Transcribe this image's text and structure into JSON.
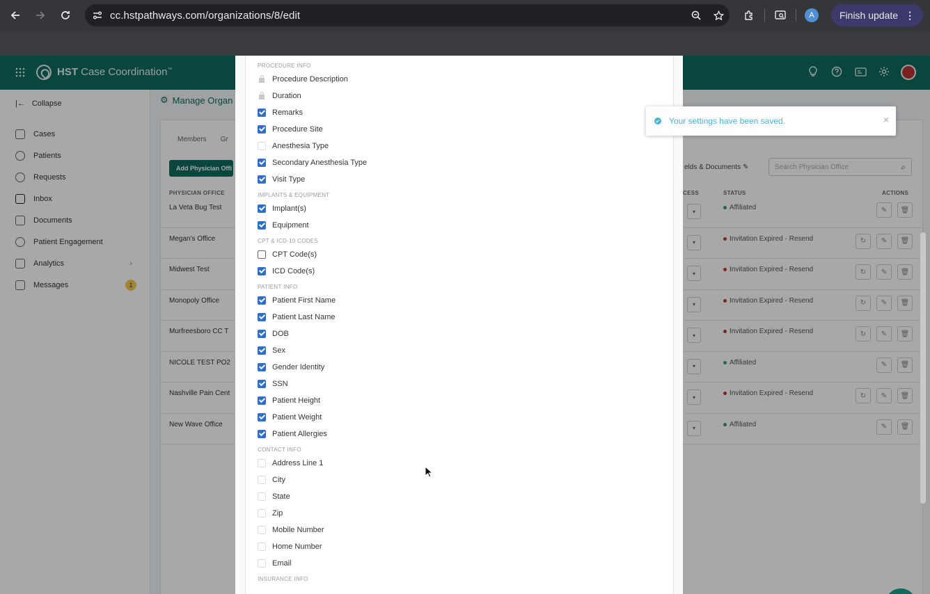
{
  "browser": {
    "url": "cc.hstpathways.com/organizations/8/edit",
    "avatar_letter": "A",
    "finish_update_label": "Finish update"
  },
  "app": {
    "brand_bold": "HST",
    "brand_rest": " Case Coordination",
    "brand_mark": "™",
    "colors": {
      "brand": "#0f6b5e",
      "checkbox": "#2f6fc4",
      "toast": "#4ab3d6"
    }
  },
  "sidebar": {
    "collapse_label": "Collapse",
    "items": [
      {
        "label": "Cases",
        "icon": "briefcase-icon"
      },
      {
        "label": "Patients",
        "icon": "users-icon"
      },
      {
        "label": "Requests",
        "icon": "check-circle-icon"
      },
      {
        "label": "Inbox",
        "icon": "inbox-icon"
      },
      {
        "label": "Documents",
        "icon": "document-icon"
      },
      {
        "label": "Patient Engagement",
        "icon": "engagement-icon"
      },
      {
        "label": "Analytics",
        "icon": "chart-icon"
      },
      {
        "label": "Messages",
        "icon": "message-icon",
        "badge": "1"
      }
    ]
  },
  "main": {
    "manage_tab": "Manage Organ",
    "subtabs": [
      "Members",
      "Gr"
    ],
    "add_button": "Add Physician Offi",
    "fields_link": "elds & Documents",
    "search_placeholder": "Search Physician Office",
    "columns": {
      "office": "PHYSICIAN OFFICE",
      "access": "CESS",
      "status": "STATUS",
      "actions": "ACTIONS"
    },
    "rows": [
      {
        "name": "La Veta Bug Test",
        "status": "Affiliated",
        "dot": "#2fa36b"
      },
      {
        "name": "Megan's Office",
        "status": "Invitation Expired - Resend",
        "dot": "#c0392b"
      },
      {
        "name": "Midwest Test",
        "status": "Invitation Expired - Resend",
        "dot": "#c0392b"
      },
      {
        "name": "Monopoly Office",
        "status": "Invitation Expired - Resend",
        "dot": "#c0392b"
      },
      {
        "name": "Murfreesboro CC T",
        "status": "Invitation Expired - Resend",
        "dot": "#c0392b"
      },
      {
        "name": "NICOLE TEST PO2",
        "status": "Affiliated",
        "dot": "#2fa36b"
      },
      {
        "name": "Nashville Pain Cent",
        "status": "Invitation Expired - Resend",
        "dot": "#c0392b"
      },
      {
        "name": "New Wave Office",
        "status": "Affiliated",
        "dot": "#2fa36b"
      }
    ]
  },
  "modal": {
    "sections": [
      {
        "title": "PROCEDURE INFO",
        "items": [
          {
            "label": "Procedure Description",
            "state": "locked"
          },
          {
            "label": "Duration",
            "state": "locked"
          },
          {
            "label": "Remarks",
            "state": "checked"
          },
          {
            "label": "Procedure Site",
            "state": "checked"
          },
          {
            "label": "Anesthesia Type",
            "state": "unchecked"
          },
          {
            "label": "Secondary Anesthesia Type",
            "state": "checked"
          },
          {
            "label": "Visit Type",
            "state": "checked"
          }
        ]
      },
      {
        "title": "IMPLANTS & EQUIPMENT",
        "items": [
          {
            "label": "Implant(s)",
            "state": "checked"
          },
          {
            "label": "Equipment",
            "state": "checked"
          }
        ]
      },
      {
        "title": "CPT & ICD-10 CODES",
        "items": [
          {
            "label": "CPT Code(s)",
            "state": "unchecked-focus"
          },
          {
            "label": "ICD Code(s)",
            "state": "checked"
          }
        ]
      },
      {
        "title": "PATIENT INFO",
        "items": [
          {
            "label": "Patient First Name",
            "state": "checked"
          },
          {
            "label": "Patient Last Name",
            "state": "checked"
          },
          {
            "label": "DOB",
            "state": "checked"
          },
          {
            "label": "Sex",
            "state": "checked"
          },
          {
            "label": "Gender Identity",
            "state": "checked"
          },
          {
            "label": "SSN",
            "state": "checked"
          },
          {
            "label": "Patient Height",
            "state": "checked"
          },
          {
            "label": "Patient Weight",
            "state": "checked"
          },
          {
            "label": "Patient Allergies",
            "state": "checked"
          }
        ]
      },
      {
        "title": "CONTACT INFO",
        "items": [
          {
            "label": "Address Line 1",
            "state": "unchecked"
          },
          {
            "label": "City",
            "state": "unchecked"
          },
          {
            "label": "State",
            "state": "unchecked"
          },
          {
            "label": "Zip",
            "state": "unchecked"
          },
          {
            "label": "Mobile Number",
            "state": "unchecked"
          },
          {
            "label": "Home Number",
            "state": "unchecked"
          },
          {
            "label": "Email",
            "state": "unchecked"
          }
        ]
      },
      {
        "title": "INSURANCE INFO",
        "items": []
      }
    ]
  },
  "toast": {
    "message": "Your settings have been saved."
  }
}
